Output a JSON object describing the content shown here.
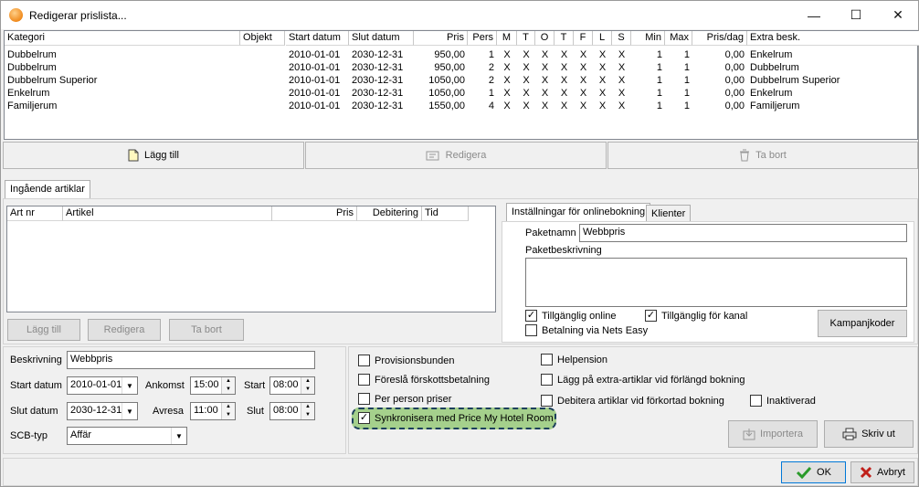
{
  "window": {
    "title": "Redigerar prislista...",
    "minimize": "—",
    "maximize": "☐",
    "close": "✕"
  },
  "grid": {
    "headers": [
      "Kategori",
      "Objekt",
      "Start datum",
      "Slut datum",
      "Pris",
      "Pers",
      "M",
      "T",
      "O",
      "T",
      "F",
      "L",
      "S",
      "Min",
      "Max",
      "Pris/dag",
      "Extra besk."
    ],
    "rows": [
      [
        "Dubbelrum",
        "",
        "2010-01-01",
        "2030-12-31",
        "950,00",
        "1",
        "X",
        "X",
        "X",
        "X",
        "X",
        "X",
        "X",
        "1",
        "1",
        "0,00",
        "Enkelrum"
      ],
      [
        "Dubbelrum",
        "",
        "2010-01-01",
        "2030-12-31",
        "950,00",
        "2",
        "X",
        "X",
        "X",
        "X",
        "X",
        "X",
        "X",
        "1",
        "1",
        "0,00",
        "Dubbelrum"
      ],
      [
        "Dubbelrum Superior",
        "",
        "2010-01-01",
        "2030-12-31",
        "1050,00",
        "2",
        "X",
        "X",
        "X",
        "X",
        "X",
        "X",
        "X",
        "1",
        "1",
        "0,00",
        "Dubbelrum Superior"
      ],
      [
        "Enkelrum",
        "",
        "2010-01-01",
        "2030-12-31",
        "1050,00",
        "1",
        "X",
        "X",
        "X",
        "X",
        "X",
        "X",
        "X",
        "1",
        "1",
        "0,00",
        "Enkelrum"
      ],
      [
        "Familjerum",
        "",
        "2010-01-01",
        "2030-12-31",
        "1550,00",
        "4",
        "X",
        "X",
        "X",
        "X",
        "X",
        "X",
        "X",
        "1",
        "1",
        "0,00",
        "Familjerum"
      ]
    ]
  },
  "actions": {
    "add": "Lägg till",
    "edit": "Redigera",
    "delete": "Ta bort"
  },
  "articles": {
    "tab": "Ingående artiklar",
    "headers": [
      "Art nr",
      "Artikel",
      "Pris",
      "Debitering",
      "Tid"
    ],
    "add": "Lägg till",
    "edit": "Redigera",
    "delete": "Ta bort"
  },
  "online": {
    "tab1": "Inställningar för onlinebokning",
    "tab2": "Klienter",
    "package_name_label": "Paketnamn",
    "package_name": "Webbpris",
    "package_desc_label": "Paketbeskrivning",
    "available_online": "Tillgänglig online",
    "available_channel": "Tillgänglig för kanal",
    "nets": "Betalning via Nets Easy",
    "campaign": "Kampanjkoder"
  },
  "form": {
    "desc_label": "Beskrivning",
    "desc": "Webbpris",
    "start_label": "Start datum",
    "start": "2010-01-01",
    "end_label": "Slut datum",
    "end": "2030-12-31",
    "arrive_label": "Ankomst",
    "arrive": "15:00",
    "depart_label": "Avresa",
    "depart": "11:00",
    "time_start_label": "Start",
    "time_start": "08:00",
    "time_end_label": "Slut",
    "time_end": "08:00",
    "scb_label": "SCB-typ",
    "scb": "Affär"
  },
  "options": {
    "provision": "Provisionsbunden",
    "prepay": "Föreslå förskottsbetalning",
    "per_person": "Per person priser",
    "sync": "Synkronisera med Price My Hotel Room",
    "full_board": "Helpension",
    "add_extra": "Lägg på extra-artiklar vid förlängd bokning",
    "charge_short": "Debitera artiklar vid förkortad bokning",
    "inactive": "Inaktiverad",
    "import": "Importera",
    "print": "Skriv ut"
  },
  "footer": {
    "ok": "OK",
    "cancel": "Avbryt"
  }
}
